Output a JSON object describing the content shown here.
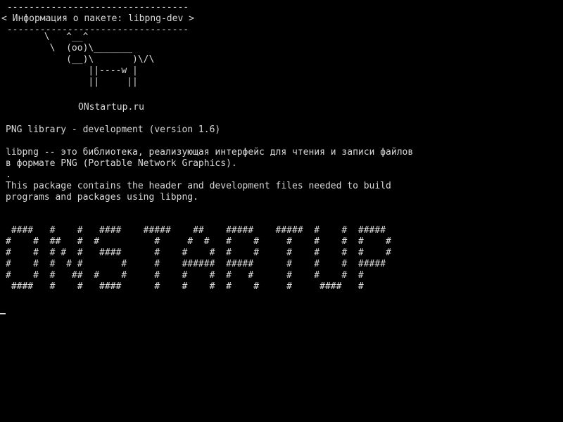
{
  "terminal": {
    "header": [
      " ---------------------------------",
      "< Информация о пакете: libpng-dev >",
      " ---------------------------------"
    ],
    "cow": [
      "       \\   ^__^",
      "        \\  (oo)\\_______",
      "           (__)\\       )\\/\\",
      "               ||----w |",
      "               ||     ||"
    ],
    "site": "ONstartup.ru",
    "description": [
      "PNG library - development (version 1.6)",
      "",
      "libpng -- это библиотека, реализующая интерфейс для чтения и записи файлов",
      "в формате PNG (Portable Network Graphics).",
      ".",
      "This package contains the header and development files needed to build",
      "programs and packages using libpng."
    ],
    "banner": [
      " ####   #    #   ####    #####    ##    #####    #####  #    #  #####",
      "#    #  ##   #  #          #     #  #   #    #     #    #    #  #    #",
      "#    #  # #  #   ####      #    #    #  #    #     #    #    #  #    #",
      "#    #  #  # #       #     #    ######  #####      #    #    #  #####",
      "#    #  #   ##  #    #     #    #    #  #   #      #    #    #  #",
      " ####   #    #   ####      #    #    #  #    #     #     ####   #"
    ],
    "colors": {
      "background": "#000000",
      "foreground": "#d9d9d9"
    }
  }
}
